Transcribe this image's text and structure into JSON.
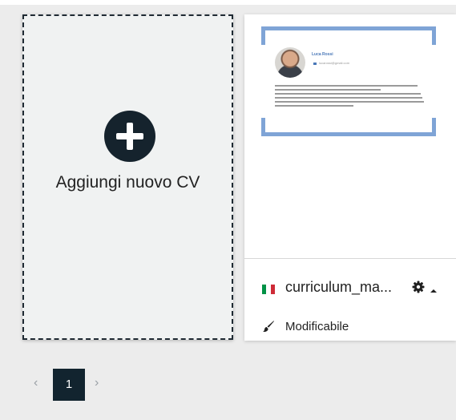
{
  "new_cv_card": {
    "label": "Aggiungi nuovo CV",
    "icon": "plus-circle-icon"
  },
  "cv_card": {
    "preview": {
      "name": "Luca Rossi",
      "email": "lucarossi@gmail.com",
      "accent_color": "#7fa4d6"
    },
    "flag_colors": [
      "#009246",
      "#ffffff",
      "#ce2b37"
    ],
    "filename": "curriculum_ma...",
    "settings_icon": "gear-icon",
    "menu_icon": "caret-up-icon",
    "status_icon": "paintbrush-icon",
    "status": "Modificabile"
  },
  "pagination": {
    "prev_label": "‹",
    "current_page": "1",
    "next_label": "›"
  },
  "colors": {
    "dark": "#15232d",
    "background": "#ececec",
    "dashed_border": "#1f2a33"
  }
}
